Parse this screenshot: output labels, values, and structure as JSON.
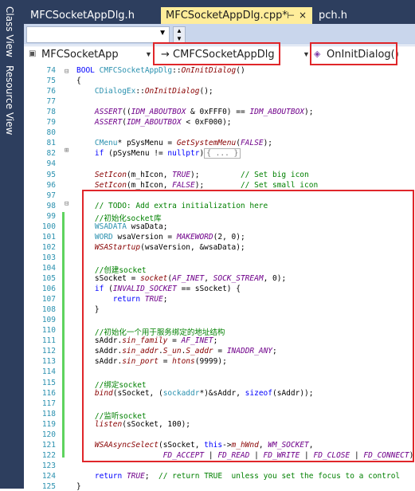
{
  "side_tabs": [
    "Class View",
    "Resource View"
  ],
  "tabs": [
    {
      "label": "MFCSocketAppDlg.h",
      "active": false
    },
    {
      "label": "MFCSocketAppDlg.cpp*",
      "active": true,
      "pin": "⊢",
      "close": "×"
    },
    {
      "label": "pch.h",
      "active": false
    }
  ],
  "nav": {
    "project": "MFCSocketApp",
    "class": "→ CMFCSocketAppDlg",
    "member": "OnInitDialog()"
  },
  "colors": {
    "accent_red": "#e0262a",
    "active_tab": "#ffed9a",
    "chrome": "#2d3e5e"
  },
  "lines": [
    {
      "n": "74",
      "html": "<span class='kw'>BOOL</span> <span class='ty'>CMFCSocketAppDlg</span>::<span class='fn'>OnInitDialog</span>()"
    },
    {
      "n": "75",
      "html": "{"
    },
    {
      "n": "76",
      "html": "    <span class='ty'>CDialogEx</span>::<span class='fn'>OnInitDialog</span>();"
    },
    {
      "n": "77",
      "html": ""
    },
    {
      "n": "78",
      "html": "    <span class='mc'>ASSERT</span>((<span class='mc'>IDM_ABOUTBOX</span> &amp; 0xFFF0) == <span class='mc'>IDM_ABOUTBOX</span>);"
    },
    {
      "n": "79",
      "html": "    <span class='mc'>ASSERT</span>(<span class='mc'>IDM_ABOUTBOX</span> &lt; 0xF000);"
    },
    {
      "n": "80",
      "html": ""
    },
    {
      "n": "81",
      "html": "    <span class='ty'>CMenu</span>* pSysMenu = <span class='fn'>GetSystemMenu</span>(<span class='mc'>FALSE</span>);"
    },
    {
      "n": "82",
      "html": "    <span class='kw'>if</span> (pSysMenu != <span class='kw'>nullptr</span>)<span class='collapsed'>{ ... }</span>"
    },
    {
      "n": "94",
      "html": ""
    },
    {
      "n": "95",
      "html": "    <span class='fn'>SetIcon</span>(m_hIcon, <span class='mc'>TRUE</span>);         <span class='cm'>// Set big icon</span>"
    },
    {
      "n": "96",
      "html": "    <span class='fn'>SetIcon</span>(m_hIcon, <span class='mc'>FALSE</span>);        <span class='cm'>// Set small icon</span>"
    },
    {
      "n": "97",
      "html": ""
    },
    {
      "n": "98",
      "html": "    <span class='cm'>// TODO: Add extra initialization here</span>"
    },
    {
      "n": "99",
      "html": "    <span class='cm'>//初始化socket库</span>"
    },
    {
      "n": "100",
      "html": "    <span class='ty'>WSADATA</span> wsaData;"
    },
    {
      "n": "101",
      "html": "    <span class='ty'>WORD</span> wsaVersion = <span class='mc'>MAKEWORD</span>(2, 0);"
    },
    {
      "n": "102",
      "html": "    <span class='fn'>WSAStartup</span>(wsaVersion, &amp;wsaData);"
    },
    {
      "n": "103",
      "html": ""
    },
    {
      "n": "104",
      "html": "    <span class='cm'>//创建socket</span>"
    },
    {
      "n": "105",
      "html": "    sSocket = <span class='fn'>socket</span>(<span class='mc'>AF_INET</span>, <span class='mc'>SOCK_STREAM</span>, 0);"
    },
    {
      "n": "106",
      "html": "    <span class='kw'>if</span> (<span class='mc'>INVALID_SOCKET</span> == sSocket) {"
    },
    {
      "n": "107",
      "html": "        <span class='kw'>return</span> <span class='mc'>TRUE</span>;"
    },
    {
      "n": "108",
      "html": "    }"
    },
    {
      "n": "109",
      "html": ""
    },
    {
      "n": "110",
      "html": "    <span class='cm'>//初始化一个用于服务绑定的地址结构</span>"
    },
    {
      "n": "111",
      "html": "    sAddr.<span class='gl'>sin_family</span> = <span class='mc'>AF_INET</span>;"
    },
    {
      "n": "112",
      "html": "    sAddr.<span class='gl'>sin_addr</span>.<span class='gl'>S_un</span>.<span class='gl'>S_addr</span> = <span class='mc'>INADDR_ANY</span>;"
    },
    {
      "n": "113",
      "html": "    sAddr.<span class='gl'>sin_port</span> = <span class='fn'>htons</span>(9999);"
    },
    {
      "n": "114",
      "html": ""
    },
    {
      "n": "115",
      "html": "    <span class='cm'>//绑定socket</span>"
    },
    {
      "n": "116",
      "html": "    <span class='fn'>bind</span>(sSocket, (<span class='ty'>sockaddr</span>*)&amp;sAddr, <span class='kw'>sizeof</span>(sAddr));"
    },
    {
      "n": "117",
      "html": ""
    },
    {
      "n": "118",
      "html": "    <span class='cm'>//监听socket</span>"
    },
    {
      "n": "119",
      "html": "    <span class='fn'>listen</span>(sSocket, 100);"
    },
    {
      "n": "120",
      "html": ""
    },
    {
      "n": "121",
      "html": "    <span class='fn'>WSAAsyncSelect</span>(sSocket, <span class='kw'>this</span>-&gt;<span class='gl'>m_hWnd</span>, <span class='mc'>WM_SOCKET</span>,"
    },
    {
      "n": "122",
      "html": "                   <span class='mc'>FD_ACCEPT</span> | <span class='mc'>FD_READ</span> | <span class='mc'>FD_WRITE</span> | <span class='mc'>FD_CLOSE</span> | <span class='mc'>FD_CONNECT</span>);"
    },
    {
      "n": "123",
      "html": ""
    },
    {
      "n": "124",
      "html": "    <span class='kw'>return</span> <span class='mc'>TRUE</span>;  <span class='cm'>// return TRUE  unless you set the focus to a control</span>"
    },
    {
      "n": "125",
      "html": "}"
    }
  ]
}
